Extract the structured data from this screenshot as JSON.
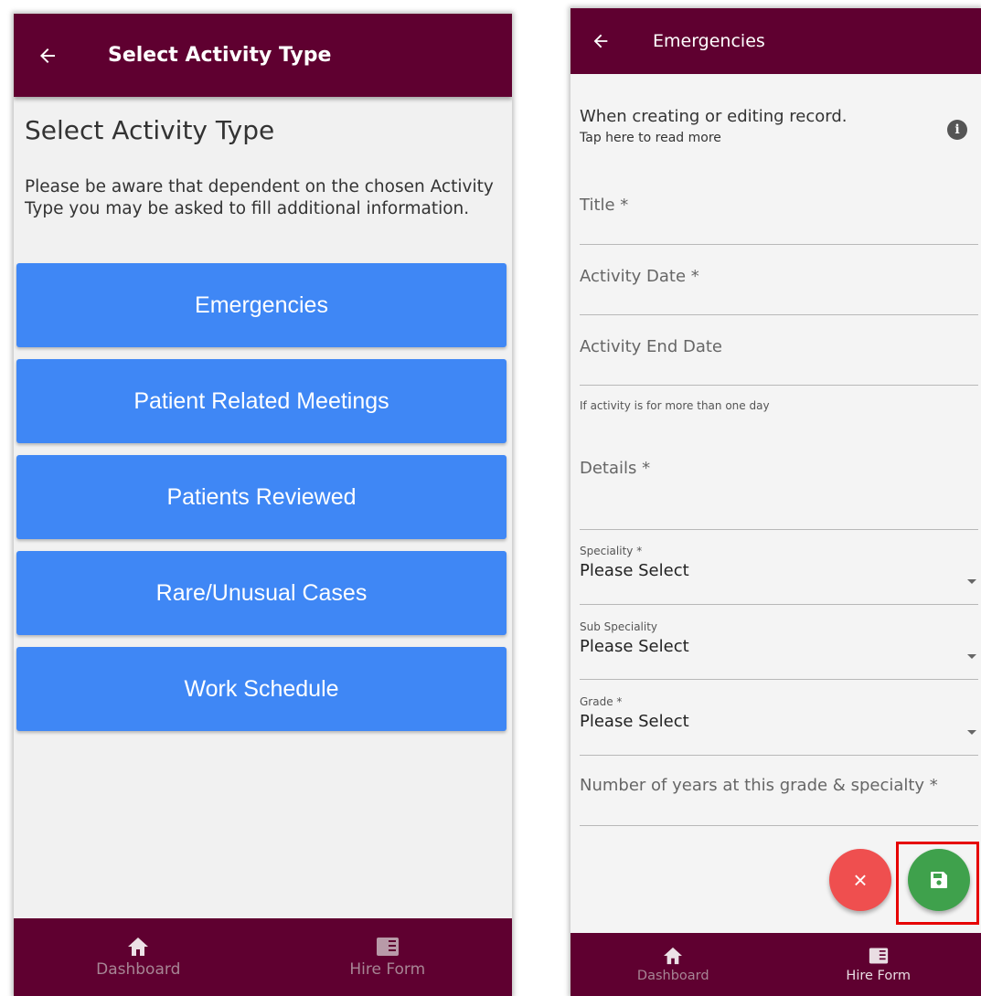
{
  "left_screen": {
    "appbar": {
      "title": "Select Activity Type"
    },
    "heading": "Select Activity Type",
    "notice": "Please be aware that dependent on the chosen Activity Type you may be asked to fill additional information.",
    "activity_types": [
      "Emergencies",
      "Patient Related Meetings",
      "Patients Reviewed",
      "Rare/Unusual Cases",
      "Work Schedule"
    ],
    "button_color": "#3f87f5",
    "nav": {
      "dashboard": "Dashboard",
      "hire_form": "Hire Form"
    }
  },
  "right_screen": {
    "appbar": {
      "title": "Emergencies"
    },
    "info": {
      "main": "When creating or editing record.",
      "sub": "Tap here to read more",
      "icon": "i"
    },
    "fields": {
      "title": "Title *",
      "activity_date": "Activity Date *",
      "activity_end_date": "Activity End Date",
      "end_date_helper": "If activity is for more than one day",
      "details": "Details *",
      "years": "Number of years at this grade & specialty *"
    },
    "selects": {
      "speciality": {
        "label": "Speciality *",
        "value": "Please Select"
      },
      "sub_speciality": {
        "label": "Sub Speciality",
        "value": "Please Select"
      },
      "grade": {
        "label": "Grade *",
        "value": "Please Select"
      }
    },
    "fab": {
      "cancel_icon": "×",
      "save_icon": "floppy-disk"
    },
    "nav": {
      "dashboard": "Dashboard",
      "hire_form": "Hire Form"
    }
  },
  "colors": {
    "primary": "#5f0030",
    "cancel": "#ef4f4f",
    "save": "#3fa14c",
    "highlight": "#e60000"
  }
}
